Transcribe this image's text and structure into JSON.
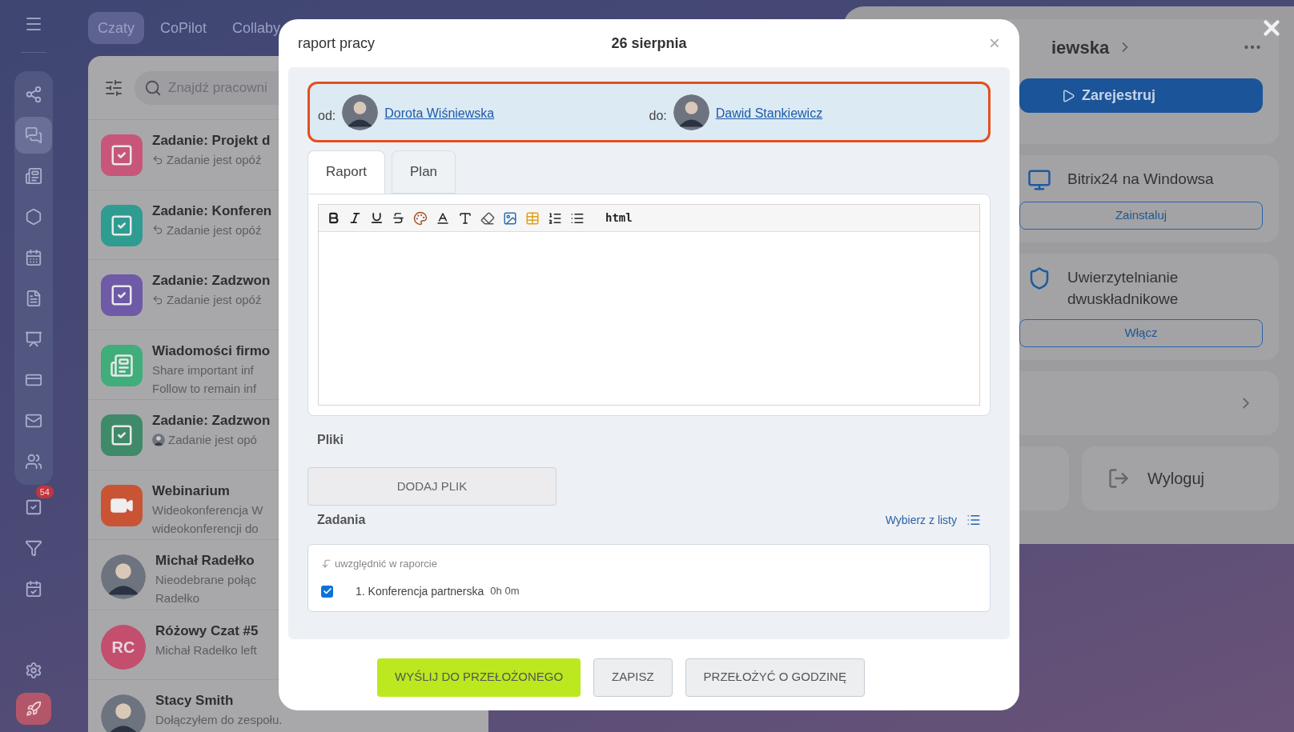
{
  "top_tabs": [
    {
      "label": "Czaty",
      "selected": true
    },
    {
      "label": "CoPilot",
      "selected": false
    },
    {
      "label": "Collaby",
      "selected": false
    }
  ],
  "rail": {
    "tasks_badge": "54"
  },
  "search": {
    "placeholder": "Znajdź pracowni"
  },
  "chats": [
    {
      "kind": "task",
      "color": "#c8567a",
      "title": "Zadanie: Projekt d",
      "lines": [
        "Zadanie jest opóź"
      ],
      "replied": true,
      "sender_avatar": false
    },
    {
      "kind": "task",
      "color": "#2f9c91",
      "title": "Zadanie: Konferen",
      "lines": [
        "Zadanie jest opóź"
      ],
      "replied": true,
      "sender_avatar": false
    },
    {
      "kind": "task",
      "color": "#6e5aa6",
      "title": "Zadanie: Zadzwon",
      "lines": [
        "Zadanie jest opóź"
      ],
      "replied": true,
      "sender_avatar": false
    },
    {
      "kind": "news",
      "color": "#3fae7a",
      "title": "Wiadomości firmo",
      "lines": [
        "Share important inf",
        "Follow to remain inf"
      ],
      "replied": false,
      "sender_avatar": false
    },
    {
      "kind": "task",
      "color": "#3f8a68",
      "title": "Zadanie: Zadzwon",
      "lines": [
        "Zadanie jest opó"
      ],
      "replied": false,
      "sender_avatar": true
    },
    {
      "kind": "video",
      "color": "#c95434",
      "title": "Webinarium",
      "lines": [
        "Wideokonferencja W",
        "wideokonferencji do"
      ],
      "replied": false,
      "sender_avatar": false
    },
    {
      "kind": "person",
      "color": "#8a8a8c",
      "title": "Michał Radełko",
      "lines": [
        "Nieodebrane połąc",
        "Radełko"
      ],
      "replied": false,
      "sender_avatar": false
    },
    {
      "kind": "initials",
      "color": "#c44e6e",
      "initials": "RC",
      "title": "Różowy Czat #5",
      "lines": [
        "Michał Radełko left"
      ],
      "replied": false,
      "sender_avatar": false
    },
    {
      "kind": "person",
      "color": "#8a8a8c",
      "title": "Stacy Smith",
      "lines": [
        "Dołączyłem do zespołu."
      ],
      "replied": false,
      "sender_avatar": false
    }
  ],
  "profile": {
    "name": "iewska",
    "register": "Zarejestruj",
    "cards": [
      {
        "kind": "desktop",
        "text": "Bitrix24 na Windowsa",
        "action": "Zainstaluj"
      },
      {
        "kind": "security",
        "text": "Uwierzytelnianie dwuskładnikowe",
        "action": "Włącz"
      }
    ],
    "logout": "Wyloguj"
  },
  "dialog": {
    "title": "raport pracy",
    "date": "26 sierpnia",
    "close": "×",
    "parties": {
      "highlighted": true,
      "from_label": "od:",
      "from_name": "Dorota Wiśniewska",
      "to_label": "do:",
      "to_name": "Dawid Stankiewicz"
    },
    "tabs": [
      {
        "label": "Raport",
        "selected": true
      },
      {
        "label": "Plan",
        "selected": false
      }
    ],
    "editor": {
      "html_button": "html"
    },
    "files_label": "Pliki",
    "add_file": "DODAJ PLIK",
    "tasks_label": "Zadania",
    "pick_from_list": "Wybierz z listy",
    "tasks_hint": "uwzględnić w raporcie",
    "tasks": [
      {
        "label": "1. Konferencja partnerska",
        "time": "0h 0m",
        "checked": true
      }
    ],
    "buttons": [
      {
        "label": "WYŚLIJ DO PRZEŁOŻONEGO",
        "kind": "primary"
      },
      {
        "label": "ZAPISZ",
        "kind": "secondary"
      },
      {
        "label": "PRZEŁOŻYĆ O GODZINĘ",
        "kind": "secondary"
      }
    ]
  }
}
